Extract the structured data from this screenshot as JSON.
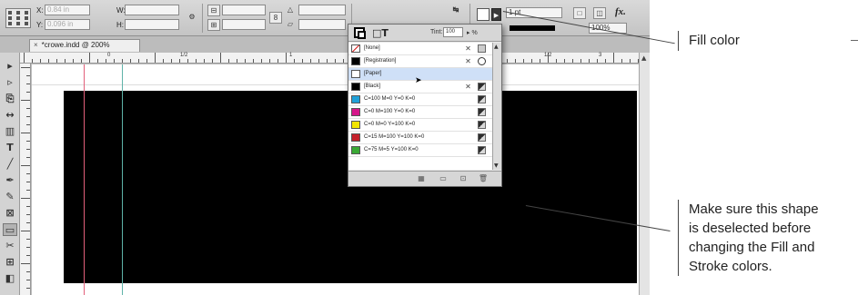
{
  "document_tab": {
    "close": "×",
    "title": "*crowe.indd @ 200%"
  },
  "control_bar": {
    "x_label": "X:",
    "x_value": "0.84 in",
    "y_label": "Y:",
    "y_value": "0.096 in",
    "w_label": "W:",
    "h_label": "H:",
    "fill_arrow": "▶",
    "stroke_weight": "1 pt",
    "opacity": "100%",
    "fx_label": "fx."
  },
  "ruler": {
    "marks": [
      "0",
      "1/2",
      "1",
      "1/2",
      "2",
      "1/2",
      "3"
    ]
  },
  "swatches_panel": {
    "format_label": "T",
    "tint_label": "Tint:",
    "tint_value": "100",
    "tint_unit": "%",
    "rows": [
      {
        "name": "[None]",
        "chip": "none",
        "i1": "✕",
        "i2": "none"
      },
      {
        "name": "[Registration]",
        "chip": "#000000",
        "i1": "✕",
        "i2": "reg"
      },
      {
        "name": "[Paper]",
        "chip": "#ffffff",
        "i1": "",
        "i2": "",
        "selected": true
      },
      {
        "name": "[Black]",
        "chip": "#000000",
        "i1": "✕",
        "i2": "proc"
      },
      {
        "name": "C=100 M=0 Y=0 K=0",
        "chip": "#1fa0d8",
        "i1": "",
        "i2": "proc"
      },
      {
        "name": "C=0 M=100 Y=0 K=0",
        "chip": "#d6168a",
        "i1": "",
        "i2": "proc"
      },
      {
        "name": "C=0 M=0 Y=100 K=0",
        "chip": "#f2e500",
        "i1": "",
        "i2": "proc"
      },
      {
        "name": "C=15 M=100 Y=100 K=0",
        "chip": "#c4202a",
        "i1": "",
        "i2": "proc"
      },
      {
        "name": "C=75 M=5 Y=100 K=0",
        "chip": "#3aa935",
        "i1": "",
        "i2": "proc"
      }
    ]
  },
  "tools": [
    "▸",
    "▹",
    "⎘",
    "↔",
    "▥",
    "T",
    "╱",
    "✒",
    "✎",
    "⊠",
    "▭",
    "✂",
    "⊞",
    "◧"
  ],
  "callouts": {
    "fill_color": "Fill color",
    "deselect_line1": "Make sure this shape",
    "deselect_line2": "is deselected before",
    "deselect_line3": "changing the Fill and",
    "deselect_line4": "Stroke colors."
  }
}
